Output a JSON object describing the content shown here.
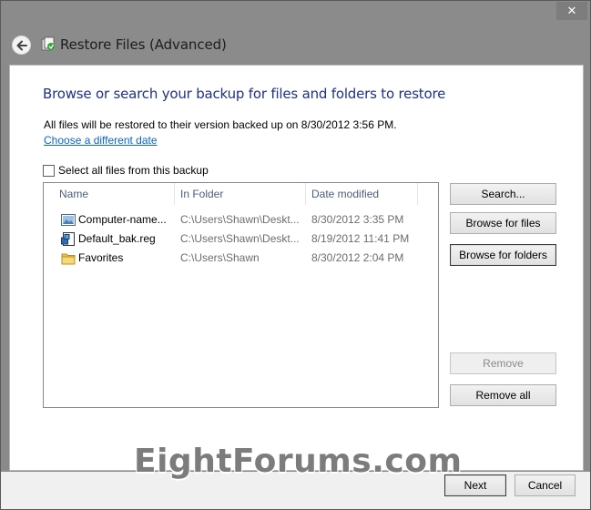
{
  "window": {
    "title": "Restore Files (Advanced)",
    "close_glyph": "✕"
  },
  "main": {
    "heading": "Browse or search your backup for files and folders to restore",
    "info": "All files will be restored to their version backed up on 8/30/2012 3:56 PM.",
    "choose_date_link": "Choose a different date",
    "select_all_label": "Select all files from this backup",
    "select_all_checked": false
  },
  "list": {
    "columns": [
      "Name",
      "In Folder",
      "Date modified"
    ],
    "rows": [
      {
        "name": "Computer-name...",
        "folder": "C:\\Users\\Shawn\\Deskt...",
        "date": "8/30/2012 3:35 PM",
        "icon": "image-file-icon"
      },
      {
        "name": "Default_bak.reg",
        "folder": "C:\\Users\\Shawn\\Deskt...",
        "date": "8/19/2012 11:41 PM",
        "icon": "registry-file-icon"
      },
      {
        "name": "Favorites",
        "folder": "C:\\Users\\Shawn",
        "date": "8/30/2012 2:04 PM",
        "icon": "folder-icon"
      }
    ]
  },
  "buttons": {
    "search": "Search...",
    "browse_files": "Browse for files",
    "browse_folders": "Browse for folders",
    "remove": "Remove",
    "remove_all": "Remove all",
    "next": "Next",
    "cancel": "Cancel"
  },
  "watermark": "EightForums.com",
  "colors": {
    "heading": "#1e3287",
    "link": "#0b66cc",
    "titlebar": "#8b8b8b"
  }
}
